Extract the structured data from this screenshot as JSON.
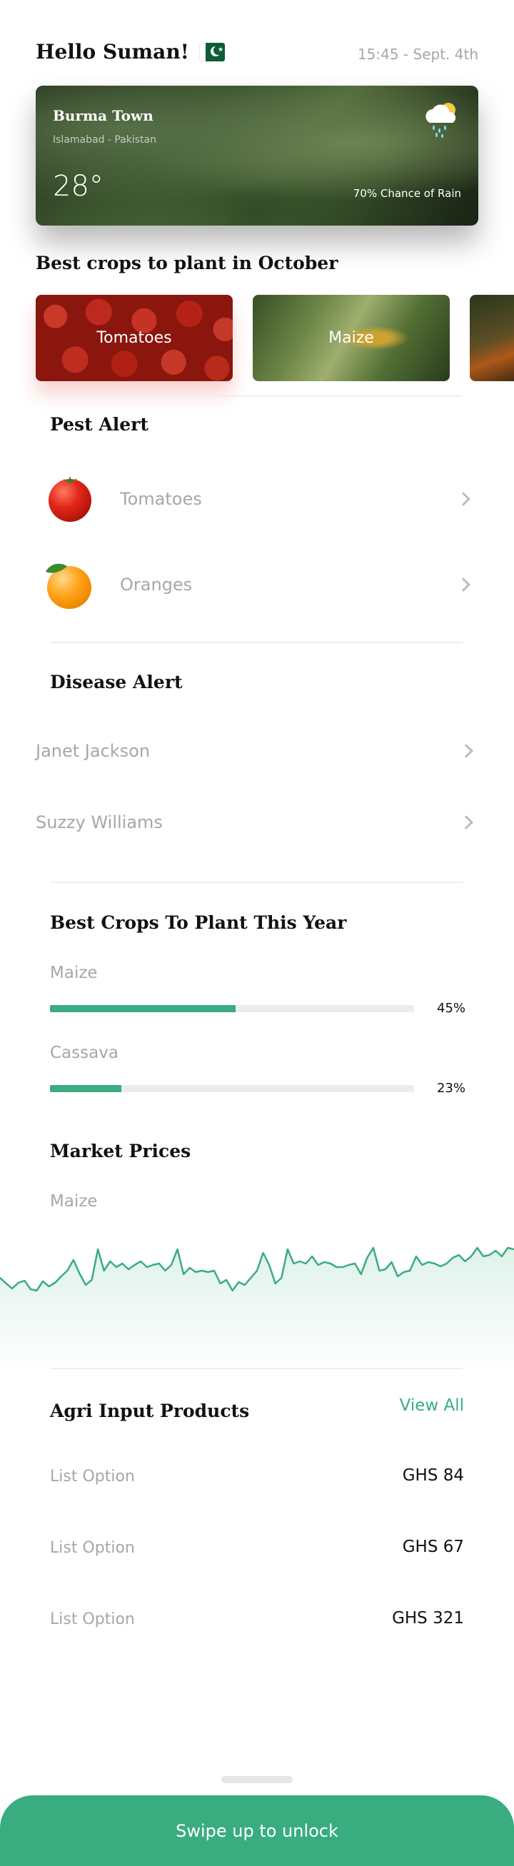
{
  "header": {
    "greeting": "Hello Suman!",
    "flag_icon": "pakistan-flag-icon",
    "datetime": "15:45 - Sept. 4th"
  },
  "weather": {
    "location": "Burma Town",
    "region": "Islamabad - Pakistan",
    "temperature": "28°",
    "rain_text": "70% Chance of Rain",
    "icon": "cloud-sun-rain-icon"
  },
  "best_crops_october": {
    "title": "Best crops to plant in October",
    "items": [
      {
        "label": "Tomatoes"
      },
      {
        "label": "Maize"
      },
      {
        "label": ""
      }
    ]
  },
  "pest_alert": {
    "title": "Pest Alert",
    "items": [
      {
        "label": "Tomatoes",
        "icon": "tomato-icon"
      },
      {
        "label": "Oranges",
        "icon": "orange-icon"
      }
    ]
  },
  "disease_alert": {
    "title": "Disease Alert",
    "items": [
      {
        "label": "Janet Jackson"
      },
      {
        "label": "Suzzy Williams"
      }
    ]
  },
  "best_crops_year": {
    "title": "Best Crops To Plant This Year",
    "items": [
      {
        "label": "Maize",
        "percent_text": "45%",
        "value": 0.51
      },
      {
        "label": "Cassava",
        "percent_text": "23%",
        "value": 0.197
      }
    ]
  },
  "market_prices": {
    "title": "Market Prices",
    "series_label": "Maize",
    "colors": {
      "line": "#39ad7f",
      "fill_top": "#dff2ea"
    }
  },
  "chart_data": {
    "type": "area",
    "title": "",
    "xlabel": "",
    "ylabel": "",
    "ylim": [
      0,
      100
    ],
    "x": [
      0,
      1,
      2,
      3,
      4,
      5,
      6,
      7,
      8,
      9,
      10,
      11,
      12,
      13,
      14,
      15,
      16,
      17,
      18,
      19,
      20,
      21,
      22,
      23,
      24,
      25,
      26,
      27,
      28,
      29,
      30,
      31,
      32,
      33,
      34,
      35,
      36,
      37,
      38,
      39,
      40,
      41,
      42,
      43,
      44,
      45,
      46,
      47,
      48,
      49,
      50,
      51,
      52,
      53,
      54,
      55,
      56,
      57,
      58,
      59,
      60,
      61,
      62,
      63,
      64,
      65,
      66,
      67,
      68,
      69,
      70,
      71,
      72,
      73,
      74,
      75,
      76,
      77,
      78,
      79,
      80,
      81,
      82,
      83,
      84
    ],
    "series": [
      {
        "values": [
          40,
          32,
          25,
          33,
          36,
          24,
          22,
          35,
          28,
          33,
          42,
          50,
          65,
          46,
          30,
          37,
          80,
          50,
          63,
          55,
          60,
          52,
          58,
          63,
          55,
          58,
          60,
          50,
          58,
          80,
          45,
          54,
          48,
          50,
          48,
          50,
          32,
          37,
          22,
          34,
          30,
          40,
          50,
          75,
          58,
          32,
          40,
          80,
          60,
          63,
          60,
          70,
          58,
          62,
          60,
          55,
          55,
          58,
          60,
          45,
          68,
          82,
          50,
          52,
          62,
          42,
          48,
          50,
          70,
          58,
          62,
          60,
          56,
          60,
          68,
          72,
          63,
          70,
          82,
          70,
          72,
          78,
          70,
          82,
          80
        ]
      }
    ]
  },
  "agri_products": {
    "title": "Agri Input Products",
    "view_all": "View All",
    "items": [
      {
        "label": "List Option",
        "price": "GHS 84"
      },
      {
        "label": "List Option",
        "price": "GHS 67"
      },
      {
        "label": "List Option",
        "price": "GHS 321"
      }
    ]
  },
  "bottom": {
    "swipe_text": "Swipe up to unlock"
  }
}
